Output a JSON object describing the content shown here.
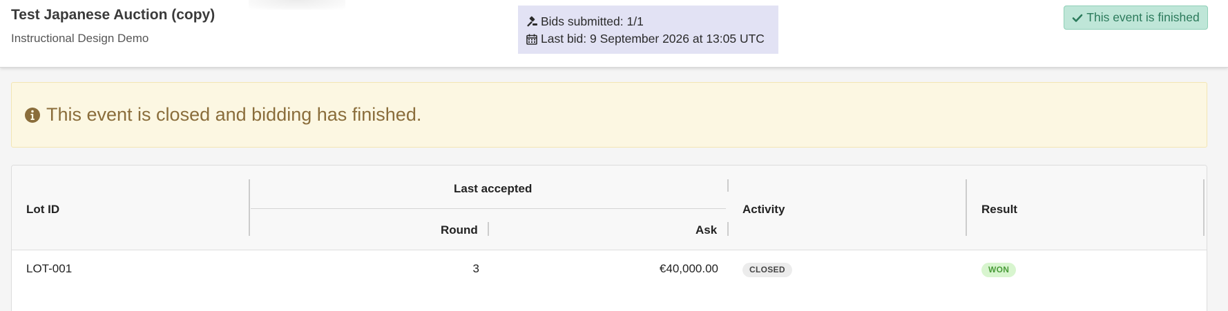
{
  "header": {
    "title": "Test Japanese Auction (copy)",
    "organization": "Instructional Design Demo",
    "bids_submitted": "Bids submitted: 1/1",
    "last_bid": "Last bid: 9 September 2026 at 13:05 UTC",
    "bids_icon": "gavel-icon",
    "last_bid_icon": "calendar-icon",
    "status_badge": "This event is finished",
    "status_badge_icon": "check-icon"
  },
  "alert": {
    "icon": "info-circle-icon",
    "message": "This event is closed and bidding has finished."
  },
  "table": {
    "headers": {
      "lot_id": "Lot ID",
      "last_accepted": "Last accepted",
      "round": "Round",
      "ask": "Ask",
      "activity": "Activity",
      "result": "Result"
    },
    "rows": [
      {
        "lot_id": "LOT-001",
        "round": "3",
        "ask": "€40,000.00",
        "activity": "CLOSED",
        "result": "WON"
      }
    ]
  },
  "colors": {
    "bid_info_bg": "#e2e2f4",
    "finished_badge_bg": "#bfe6d8",
    "finished_badge_text": "#2b7a5b",
    "alert_bg": "#fcf7e2",
    "alert_text": "#8a6d3b",
    "won_pill_bg": "#d8f5cf",
    "won_pill_text": "#4a9c3a",
    "closed_pill_bg": "#ececec"
  }
}
